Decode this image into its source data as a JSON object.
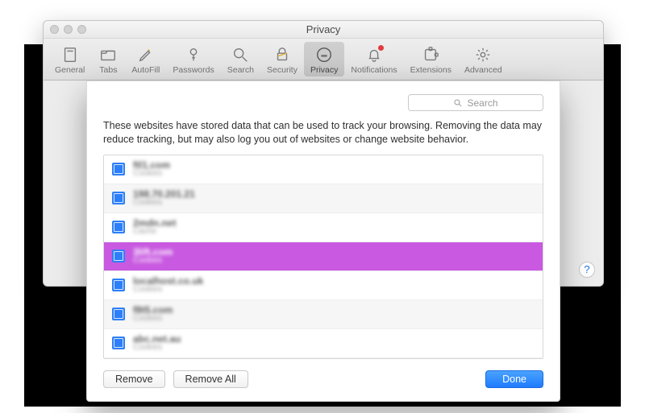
{
  "window": {
    "title": "Privacy"
  },
  "toolbar": {
    "items": [
      {
        "id": "general",
        "label": "General"
      },
      {
        "id": "tabs",
        "label": "Tabs"
      },
      {
        "id": "autofill",
        "label": "AutoFill"
      },
      {
        "id": "passwords",
        "label": "Passwords"
      },
      {
        "id": "search",
        "label": "Search"
      },
      {
        "id": "security",
        "label": "Security"
      },
      {
        "id": "privacy",
        "label": "Privacy",
        "selected": true
      },
      {
        "id": "notifications",
        "label": "Notifications",
        "badge": true
      },
      {
        "id": "extensions",
        "label": "Extensions"
      },
      {
        "id": "advanced",
        "label": "Advanced"
      }
    ]
  },
  "sheet": {
    "search_placeholder": "Search",
    "description": "These websites have stored data that can be used to track your browsing. Removing the data may reduce tracking, but may also log you out of websites or change website behavior.",
    "rows": [
      {
        "domain": "ftl1.com",
        "detail": "Cookies"
      },
      {
        "domain": "198.70.201.21",
        "detail": "Cookies"
      },
      {
        "domain": "2mdn.net",
        "detail": "Cache"
      },
      {
        "domain": "3lift.com",
        "detail": "Cookies",
        "selected": true
      },
      {
        "domain": "localhost.co.uk",
        "detail": "Cookies"
      },
      {
        "domain": "f8t5.com",
        "detail": "Cookies"
      },
      {
        "domain": "abc.net.au",
        "detail": "Cookies"
      }
    ],
    "buttons": {
      "remove": "Remove",
      "remove_all": "Remove All",
      "done": "Done"
    }
  },
  "help_label": "?"
}
